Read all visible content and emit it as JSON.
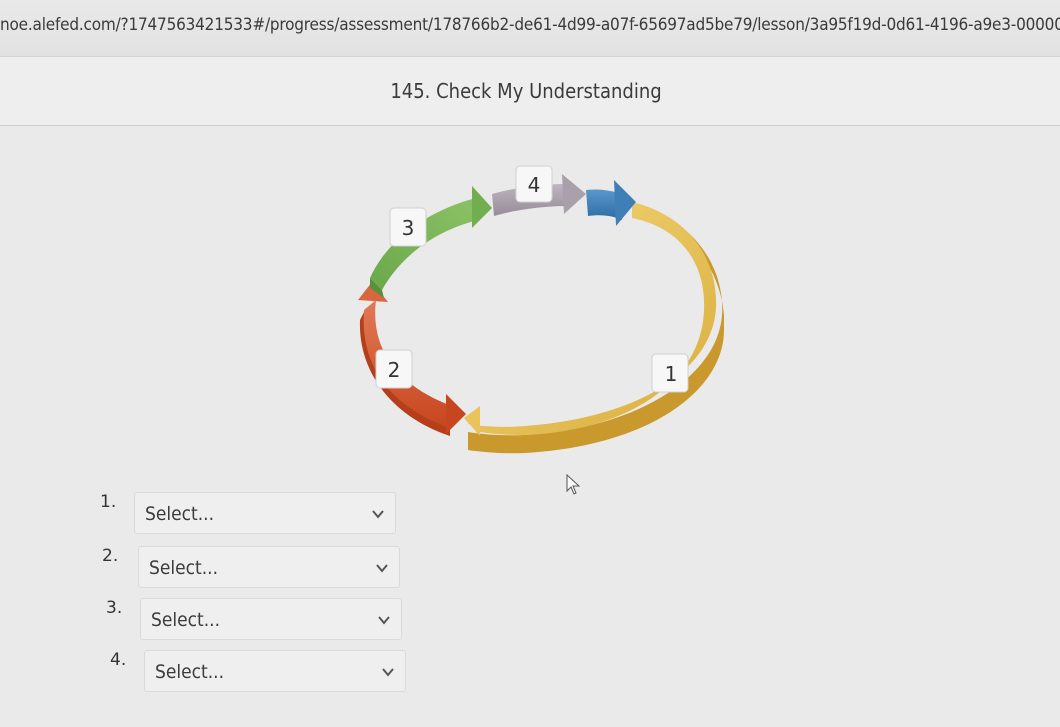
{
  "browser": {
    "url": "noe.alefed.com/?1747563421533#/progress/assessment/178766b2-de61-4d99-a07f-65697ad5be79/lesson/3a95f19d-0d61-4196-a9e3-0000000..."
  },
  "lesson": {
    "title": "145. Check My Understanding"
  },
  "cycle_diagram": {
    "steps": [
      {
        "label": "1",
        "color": "#e9c45a"
      },
      {
        "label": "2",
        "color": "#d3552f"
      },
      {
        "label": "3",
        "color": "#7db357"
      },
      {
        "label": "4",
        "color": "#a9a0ab"
      },
      {
        "label": "",
        "color": "#3f7fb8"
      }
    ]
  },
  "questions": [
    {
      "number": "1.",
      "placeholder": "Select..."
    },
    {
      "number": "2.",
      "placeholder": "Select..."
    },
    {
      "number": "3.",
      "placeholder": "Select..."
    },
    {
      "number": "4.",
      "placeholder": "Select..."
    }
  ]
}
